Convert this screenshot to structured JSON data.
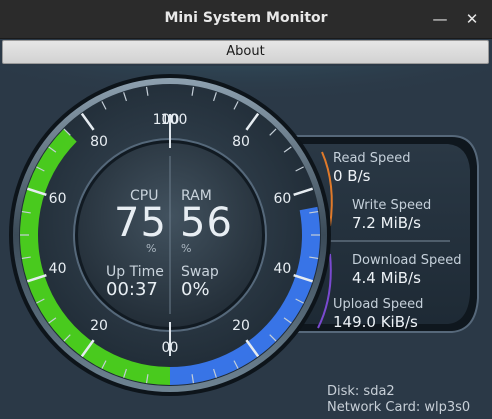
{
  "window": {
    "title": "Mini System Monitor"
  },
  "toolbar": {
    "about_label": "About"
  },
  "gauges": {
    "cpu": {
      "label": "CPU",
      "value": "75",
      "unit": "%",
      "ticks": [
        "0",
        "20",
        "40",
        "60",
        "80",
        "100"
      ],
      "level": 0.75,
      "color": "#4cd31c"
    },
    "ram": {
      "label": "RAM",
      "value": "56",
      "unit": "%",
      "ticks": [
        "0",
        "20",
        "40",
        "60",
        "80",
        "100"
      ],
      "level": 0.56,
      "color": "#3a78f0"
    }
  },
  "uptime": {
    "label": "Up Time",
    "value": "00:37"
  },
  "swap": {
    "label": "Swap",
    "value": "0%"
  },
  "speeds": {
    "read": {
      "label": "Read Speed",
      "value": "0 B/s",
      "color": "#e07a2a"
    },
    "write": {
      "label": "Write Speed",
      "value": "7.2 MiB/s"
    },
    "download": {
      "label": "Download Speed",
      "value": "4.4 MiB/s"
    },
    "upload": {
      "label": "Upload Speed",
      "value": "149.0 KiB/s",
      "color": "#7a4ad0"
    }
  },
  "footer": {
    "disk": "Disk: sda2",
    "network": "Network Card: wlp3s0"
  }
}
